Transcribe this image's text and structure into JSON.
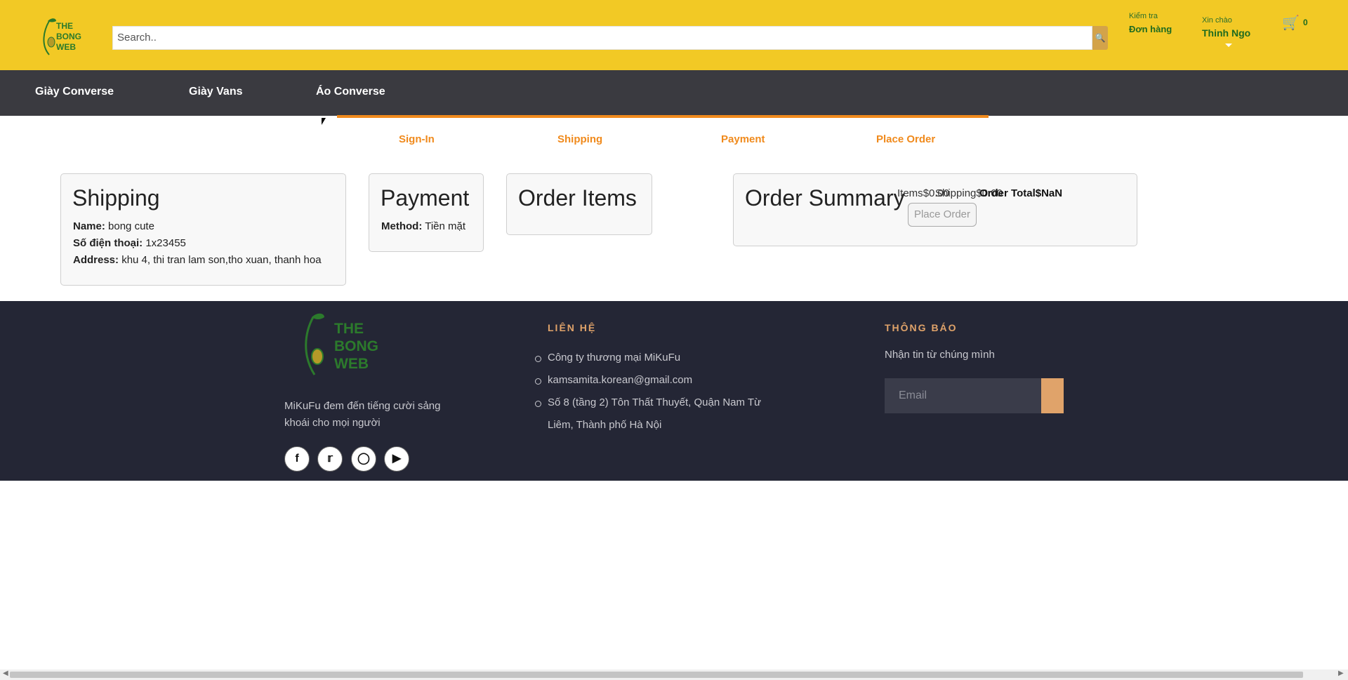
{
  "header": {
    "logo_lines": [
      "THE",
      "BONG",
      "WEB"
    ],
    "search_placeholder": "Search..",
    "orders_label_small": "Kiểm tra",
    "orders_label_big": "Đơn hàng",
    "greeting_small": "Xin chào",
    "user_name": "Thinh Ngo",
    "cart_count": "0"
  },
  "nav": {
    "items": [
      "Giày Converse",
      "Giày Vans",
      "Áo Converse"
    ]
  },
  "steps": [
    "Sign-In",
    "Shipping",
    "Payment",
    "Place Order"
  ],
  "shipping": {
    "title": "Shipping",
    "name_label": "Name:",
    "name_value": "bong cute",
    "phone_label": "Số điện thoại:",
    "phone_value": "1x23455",
    "address_label": "Address:",
    "address_value": "khu 4, thi tran lam son,tho xuan, thanh hoa"
  },
  "payment": {
    "title": "Payment",
    "method_label": "Method:",
    "method_value": "Tiền mặt"
  },
  "order_items": {
    "title": "Order Items"
  },
  "summary": {
    "title": "Order Summary",
    "items_label": "Items",
    "items_value": "$0.00",
    "shipping_label": "Shipping",
    "shipping_value": "$0.00",
    "total_label": "Order Total",
    "total_value": "$NaN",
    "button": "Place Order"
  },
  "footer": {
    "logo_lines": [
      "THE",
      "BONG",
      "WEB"
    ],
    "desc": "MiKuFu đem đến tiếng cười sảng khoái cho mọi người",
    "social": [
      "facebook-icon",
      "twitter-icon",
      "instagram-icon",
      "youtube-icon"
    ],
    "contact_title": "LIÊN HỆ",
    "contact_items": [
      "Công ty thương mại MiKuFu",
      "kamsamita.korean@gmail.com",
      "Số 8 (tầng 2) Tôn Thất Thuyết, Quận Nam Từ",
      "Liêm, Thành phố Hà Nội"
    ],
    "notify_title": "THÔNG BÁO",
    "notify_text": "Nhận tin từ chúng mình",
    "email_placeholder": "Email"
  }
}
